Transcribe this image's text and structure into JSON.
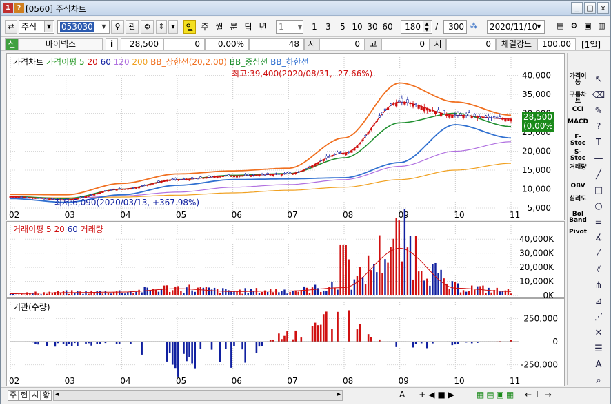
{
  "window": {
    "badge1": "1",
    "badge2": "?",
    "title": "[0560] 주식차트",
    "buttons": [
      "_",
      "□",
      "x"
    ]
  },
  "toolbar": {
    "market": "주식",
    "code": "053030",
    "btn_search": "관",
    "periods": [
      "일",
      "주",
      "월",
      "분",
      "틱",
      "년"
    ],
    "selected_period": "일",
    "unit": "1",
    "quick_units": [
      "1",
      "3",
      "5",
      "10",
      "30",
      "60"
    ],
    "count": "180",
    "slash": "/",
    "total": "300",
    "date": "2020/11/10"
  },
  "infobar": {
    "tag": "신",
    "name": "바이넥스",
    "info_btn": "i",
    "price": "28,500",
    "change": "0",
    "rate": "0.00%",
    "volume": "48",
    "open_label": "시",
    "open": "0",
    "high_label": "고",
    "high": "0",
    "low_label": "저",
    "low": "0",
    "strength_label": "체결강도",
    "strength": "100.00",
    "period_badge": "[1일]"
  },
  "colors": {
    "up": "#d01010",
    "down": "#1020a0",
    "ma5": "#2a9a2a",
    "ma20": "#d01010",
    "ma60": "#1020a0",
    "ma120": "#b070e0",
    "ma200": "#f0a020",
    "bb_upper": "#f07020",
    "bb_mid": "#209030",
    "bb_lower": "#3070d0",
    "current_badge": "#1a8a1a"
  },
  "price_pane": {
    "legend": [
      "가격차트",
      "가격이평 5",
      "20",
      "60",
      "120",
      "200",
      "BB_상한선(20,2.00)",
      "BB_중심선",
      "BB_하한선"
    ],
    "y_ticks": [
      "40,000",
      "35,000",
      "30,000",
      "25,000",
      "20,000",
      "15,000",
      "10,000",
      "5,000"
    ],
    "annotation_high": "최고:39,400(2020/08/31, -27.66%)",
    "annotation_low": "최저:6,090(2020/03/13, +367.98%)",
    "current_price": "28,500",
    "current_rate": "(0.00%)"
  },
  "volume_pane": {
    "legend": [
      "거래이평 5",
      "20",
      "60",
      "거래량"
    ],
    "y_ticks": [
      "40,000K",
      "30,000K",
      "20,000K",
      "10,000K",
      "0K"
    ]
  },
  "inst_pane": {
    "legend": [
      "기관(수량)"
    ],
    "y_ticks": [
      "250,000",
      "0",
      "-250,000"
    ]
  },
  "x_ticks": [
    "02",
    "03",
    "04",
    "05",
    "06",
    "07",
    "08",
    "09",
    "10",
    "11"
  ],
  "right_strip": [
    "가격이동",
    "구름차트",
    "CCI",
    "MACD",
    "F-Stoc",
    "S-Stoc",
    "거래량",
    "OBV",
    "심리도",
    "Bol Band",
    "Pivot"
  ],
  "draw_tools": [
    "cursor-icon",
    "eraser-icon",
    "draw-icon",
    "help-icon",
    "text-icon",
    "horizontal-line-icon",
    "diagonal-line-icon",
    "rectangle-icon",
    "circle-icon",
    "fibonacci-icon",
    "gann-icon",
    "trend-icon",
    "channel-icon",
    "andrews-icon",
    "regression-icon",
    "speed-line-icon",
    "cross-icon",
    "levels-icon",
    "auto-icon",
    "zoom-icon"
  ],
  "bottom": {
    "tabs": [
      "주",
      "현",
      "시",
      "황"
    ],
    "nav": [
      "A",
      "—",
      "+",
      "◀",
      "■",
      "▶"
    ],
    "end": [
      "←",
      "L",
      "→"
    ]
  },
  "chart_data": [
    {
      "type": "line",
      "title": "가격차트",
      "x": [
        "02",
        "03",
        "04",
        "05",
        "06",
        "07",
        "08",
        "09",
        "10",
        "11"
      ],
      "ylim": [
        3000,
        43000
      ],
      "series": [
        {
          "name": "가격",
          "values": [
            8000,
            7200,
            10000,
            12500,
            13500,
            14000,
            19500,
            33000,
            29500,
            28500
          ]
        },
        {
          "name": "BB_상한선(20,2.00)",
          "values": [
            8600,
            8500,
            11500,
            14000,
            14800,
            15500,
            23500,
            38000,
            33000,
            29500
          ]
        },
        {
          "name": "BB_하한선",
          "values": [
            7500,
            6500,
            8500,
            11000,
            12500,
            12700,
            13000,
            17000,
            27000,
            23500
          ]
        },
        {
          "name": "120",
          "values": [
            7800,
            7600,
            8200,
            9200,
            10500,
            11200,
            12500,
            16000,
            20000,
            22500
          ]
        },
        {
          "name": "200",
          "values": [
            7800,
            7700,
            7900,
            8400,
            9000,
            9700,
            10500,
            12500,
            15000,
            16800
          ]
        }
      ]
    },
    {
      "type": "bar",
      "title": "거래량",
      "x": [
        "02",
        "03",
        "04",
        "05",
        "06",
        "07",
        "08",
        "09",
        "10",
        "11"
      ],
      "ylim": [
        0,
        45000
      ],
      "values": [
        1500,
        2500,
        3000,
        6000,
        3500,
        4000,
        7000,
        42000,
        6500,
        3500
      ]
    },
    {
      "type": "bar",
      "title": "기관(수량)",
      "x": [
        "02",
        "03",
        "04",
        "05",
        "06",
        "07",
        "08",
        "09",
        "10",
        "11"
      ],
      "ylim": [
        -350000,
        350000
      ],
      "values": [
        0,
        -50000,
        -30000,
        -300000,
        -230000,
        110000,
        300000,
        -80000,
        -30000,
        20000
      ]
    }
  ]
}
